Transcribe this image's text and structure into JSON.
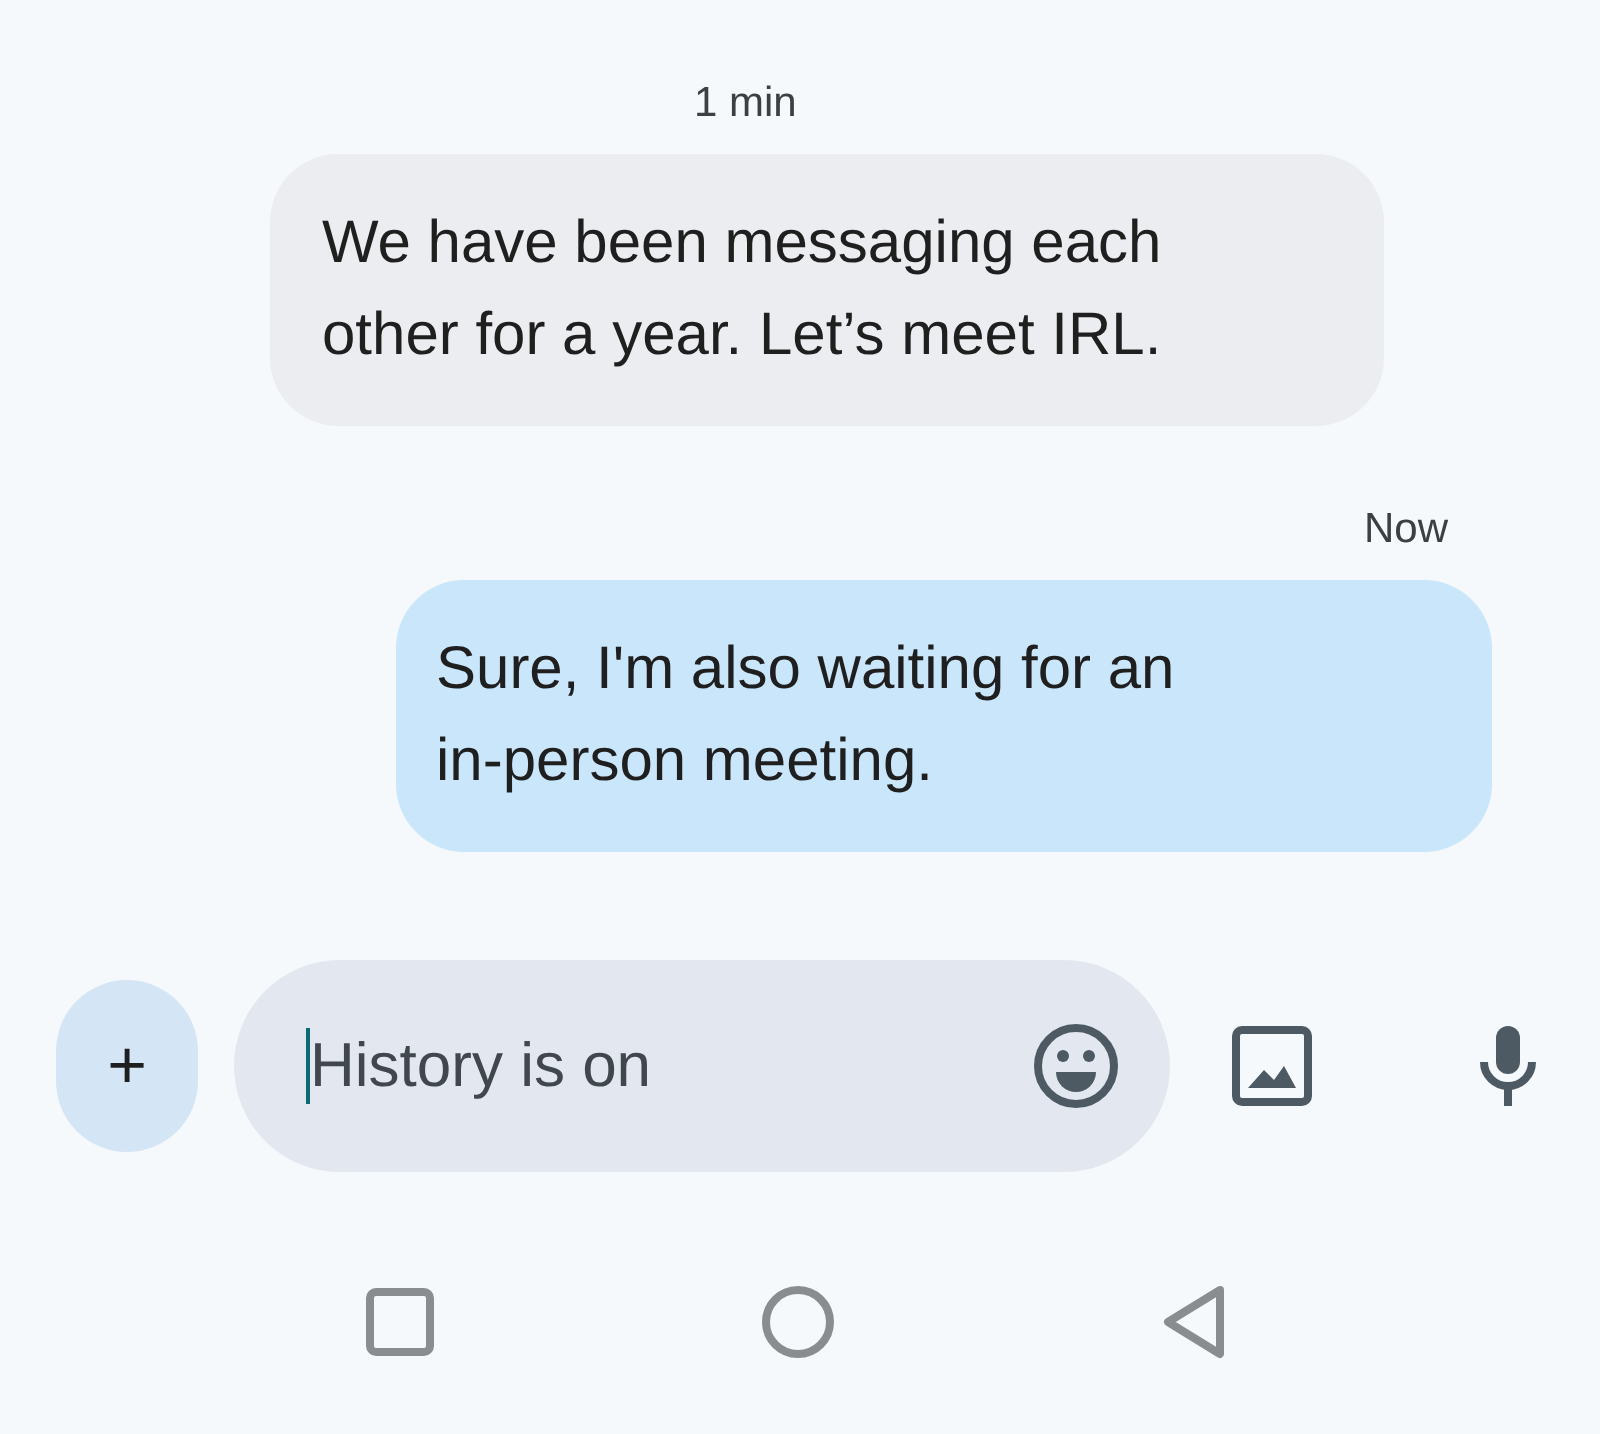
{
  "messages": [
    {
      "kind": "incoming",
      "time": "1 min",
      "text": "We have been messaging each\nother for a year. Let’s meet IRL."
    },
    {
      "kind": "outgoing",
      "time": "Now",
      "text": "Sure, I'm also waiting for an\nin-person meeting."
    }
  ],
  "composer": {
    "add_label": "+",
    "placeholder": "History is on"
  }
}
